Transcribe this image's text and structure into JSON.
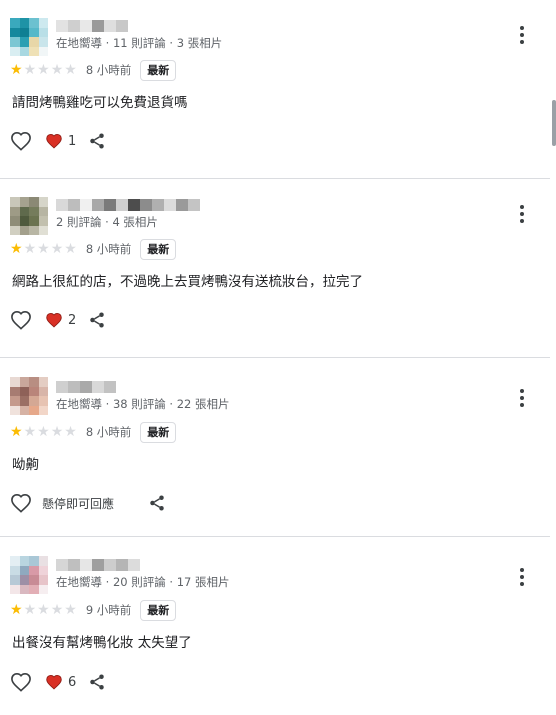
{
  "reviews": [
    {
      "meta": "在地嚮導 · 11 則評論 · 3 張相片",
      "time": "8 小時前",
      "badge": "最新",
      "rating": 1,
      "text": "請問烤鴨雞吃可以免費退貨嗎",
      "reaction_count": "1",
      "avatar_colors": [
        "#3aa9bd",
        "#1e93a6",
        "#6cc1d0",
        "#cde9ef",
        "#15889d",
        "#0f7f93",
        "#56b8c9",
        "#b9dfe7",
        "#7cc7d3",
        "#2b9fb2",
        "#e8d7a8",
        "#c9e5eb",
        "#d9eef2",
        "#a8d8e1",
        "#efe1b6",
        "#f1f6f7"
      ],
      "name_colors": [
        "#e2e2e2",
        "#cfcfcf",
        "#e8e8e8",
        "#9a9a9a",
        "#dedede",
        "#c8c8c8"
      ]
    },
    {
      "meta": "2 則評論 · 4 張相片",
      "time": "8 小時前",
      "badge": "最新",
      "rating": 1,
      "text": "網路上很紅的店，不過晚上去買烤鴨沒有送梳妝台，拉完了",
      "reaction_count": "2",
      "avatar_colors": [
        "#c9c7b9",
        "#a5a28f",
        "#8b8975",
        "#d6d5c9",
        "#9e9b86",
        "#5f6a4c",
        "#757c5c",
        "#b7b5a3",
        "#8f8d78",
        "#4f5a3d",
        "#6b7350",
        "#c2c0ae",
        "#d1cfc1",
        "#a3a08c",
        "#b8b6a4",
        "#e0dfd4"
      ],
      "name_colors": [
        "#d9d9d9",
        "#bdbdbd",
        "#f0f0f0",
        "#a8a8a8",
        "#7a7a7a",
        "#cfcfcf",
        "#4d4d4d",
        "#8c8c8c",
        "#b0b0b0",
        "#dcdcdc",
        "#9a9a9a",
        "#c4c4c4"
      ]
    },
    {
      "meta": "在地嚮導 · 38 則評論 · 22 張相片",
      "time": "8 小時前",
      "badge": "最新",
      "rating": 1,
      "text": "呦齁",
      "pause_text": "懸停即可回應",
      "avatar_colors": [
        "#e8d9d3",
        "#c9a79b",
        "#b88e82",
        "#e4cdc3",
        "#a77c72",
        "#8e6158",
        "#b9857a",
        "#d8b5a9",
        "#c59a8c",
        "#9b6f64",
        "#d4a894",
        "#e7c3b2",
        "#f0e2dc",
        "#d6b2a4",
        "#e6a88a",
        "#f2d6c8"
      ],
      "name_colors": [
        "#cfcfcf",
        "#bdbdbd",
        "#a9a9a9",
        "#d8d8d8",
        "#c2c2c2"
      ]
    },
    {
      "meta": "在地嚮導 · 20 則評論 · 17 張相片",
      "time": "9 小時前",
      "badge": "最新",
      "rating": 1,
      "text": "出餐沒有幫烤鴨化妝 太失望了",
      "reaction_count": "6",
      "avatar_colors": [
        "#e3eef3",
        "#b9d5e0",
        "#a9c7d6",
        "#e9e0e3",
        "#c9dce5",
        "#8fa9bf",
        "#d89aa7",
        "#efd3d9",
        "#b7c9d6",
        "#9d8fa6",
        "#c88b95",
        "#e7c4c9",
        "#f3e6e8",
        "#d9b8c0",
        "#e2aeb5",
        "#f6eef0"
      ],
      "name_colors": [
        "#d6d6d6",
        "#bfbfbf",
        "#e6e6e6",
        "#9f9f9f",
        "#cdcdcd",
        "#b5b5b5",
        "#dcdcdc"
      ]
    }
  ],
  "colors": {
    "heart_red": "#d93025",
    "star_gold": "#fbbc04",
    "star_grey": "#dadce0"
  }
}
